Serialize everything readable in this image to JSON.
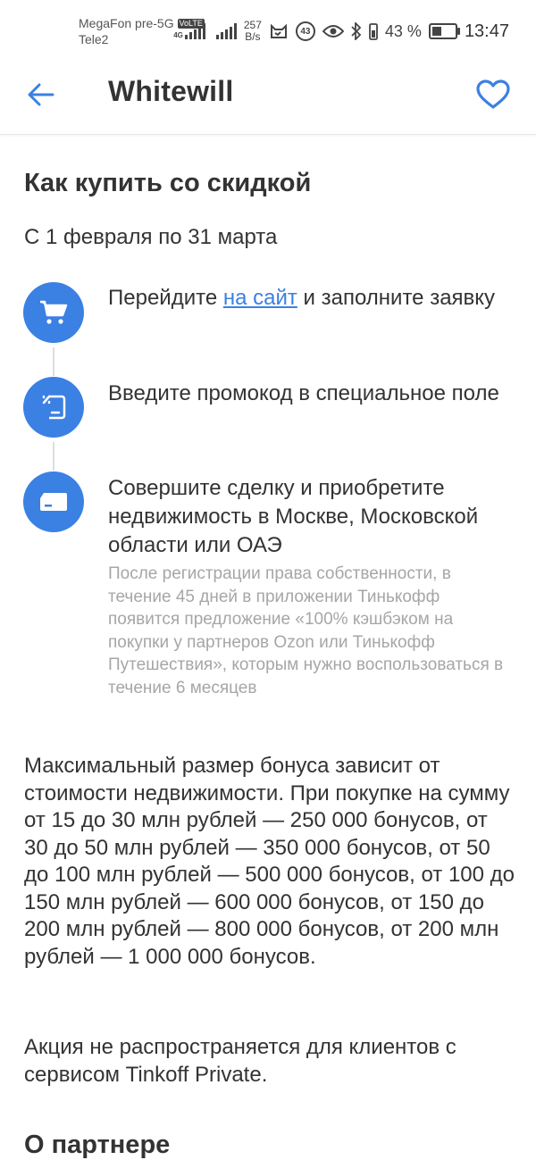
{
  "status_bar": {
    "carrier_1": "MegaFon pre-5G",
    "volte": "VoLTE",
    "carrier_2": "Tele2",
    "network": "4G",
    "net_speed_value": "257",
    "net_speed_unit": "B/s",
    "notification_count": "43",
    "battery_percent": "43 %",
    "time": "13:47"
  },
  "app_bar": {
    "title": "Whitewill",
    "back_icon": "arrow-left-icon",
    "favorite_icon": "heart-outline-icon"
  },
  "colors": {
    "accent": "#3b80e3",
    "text": "#333333",
    "note_text": "#a6a6a6"
  },
  "offer": {
    "title": "Как купить со скидкой",
    "period": "С 1 февраля по 31 марта",
    "steps": [
      {
        "icon": "shopping-cart-icon",
        "text_before": "Перейдите ",
        "link": "на сайт",
        "text_after": " и заполните заявку"
      },
      {
        "icon": "promo-code-icon",
        "text": "Введите промокод в специальное поле"
      },
      {
        "icon": "card-icon",
        "text": "Совершите сделку и приобретите недвижимость в Москве, Московской области или ОАЭ",
        "note": "После регистрации права собственности, в течение 45 дней в приложении Тинькофф появится предложение «100% кэшбэком на покупки у партнеров Ozon или Тинькофф Путешествия», которым нужно воспользоваться в течение 6 месяцев"
      }
    ],
    "bonus_info": "Максимальный размер бонуса зависит от стоимости недвижимости. При покупке на сумму от 15 до 30 млн рублей — 250 000 бонусов, от 30 до 50 млн рублей  — 350 000 бонусов, от 50 до 100 млн рублей  — 500 000 бонусов, от 100 до 150 млн рублей  — 600 000 бонусов, от 150 до 200 млн рублей — 800 000 бонусов, от 200 млн рублей — 1 000 000 бонусов.",
    "restriction": "Акция не распространяется для клиентов с сервисом Tinkoff Private."
  },
  "partners": {
    "heading": "О партнере"
  }
}
